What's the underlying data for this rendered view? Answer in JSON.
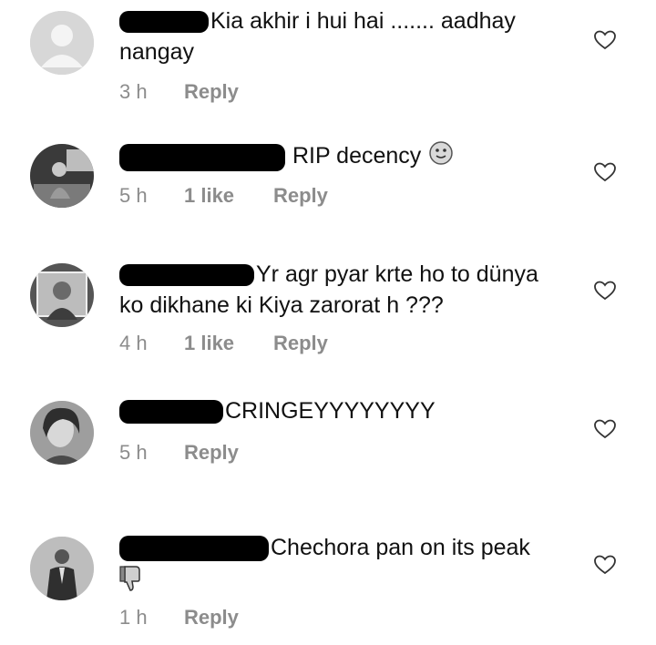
{
  "comments": [
    {
      "text_line1": "Kia akhir i hui hai ....... aadhay",
      "text_line2": "nangay",
      "time": "3 h",
      "likes": "",
      "reply": "Reply",
      "avatar_icon": "default-avatar-icon"
    },
    {
      "text_line1": "RIP decency",
      "time": "5 h",
      "likes": "1 like",
      "reply": "Reply",
      "emoji": "smiley-emoji"
    },
    {
      "text_line1": "Yr agr pyar krte ho to dünya",
      "text_line2": "ko dikhane ki Kiya zarorat h ???",
      "time": "4 h",
      "likes": "1 like",
      "reply": "Reply"
    },
    {
      "text_line1": "CRINGEYYYYYYYY",
      "time": "5 h",
      "likes": "",
      "reply": "Reply"
    },
    {
      "text_line1": "Chechora pan on its peak",
      "emoji": "thumbs-down-emoji",
      "time": "1 h",
      "likes": "",
      "reply": "Reply"
    }
  ],
  "icons": {
    "like": "heart-outline-icon"
  }
}
